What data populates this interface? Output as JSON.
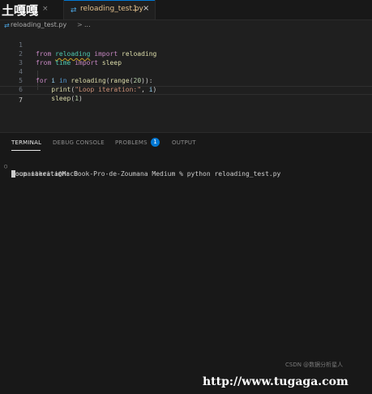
{
  "watermark_top": "土嘎嘎",
  "watermark_bottom": "http://www.tugaga.com",
  "watermark_csdn": "CSDN @数据分析星人",
  "tabs": {
    "prev_close": "×",
    "active": {
      "icon": "python-file-icon",
      "label": "reloading_test.py",
      "problems": "1",
      "close": "×"
    }
  },
  "breadcrumb": {
    "file": "reloading_test.py",
    "separator": ">",
    "more": "..."
  },
  "editor": {
    "line_numbers": [
      "1",
      "2",
      "3",
      "4",
      "5",
      "6",
      "7"
    ],
    "current_line": 7
  },
  "panel": {
    "tabs": [
      "TERMINAL",
      "DEBUG CONSOLE",
      "PROBLEMS",
      "OUTPUT"
    ],
    "active_tab": "TERMINAL",
    "problems_count": "1",
    "terminal": {
      "prompt_marker": "○",
      "prompt": "zoumanakeita@MacBook-Pro-de-Zoumana Medium % python reloading_test.py",
      "output": [
        "Loop iteration: 0"
      ]
    }
  },
  "colors": {
    "keyword": "#c586c0",
    "module": "#4ec9b0",
    "function": "#dcdcaa",
    "variable": "#9cdcfe",
    "string": "#ce9178",
    "number": "#b5cea8",
    "accent": "#0078d4",
    "modified_tab": "#e2c08d"
  }
}
